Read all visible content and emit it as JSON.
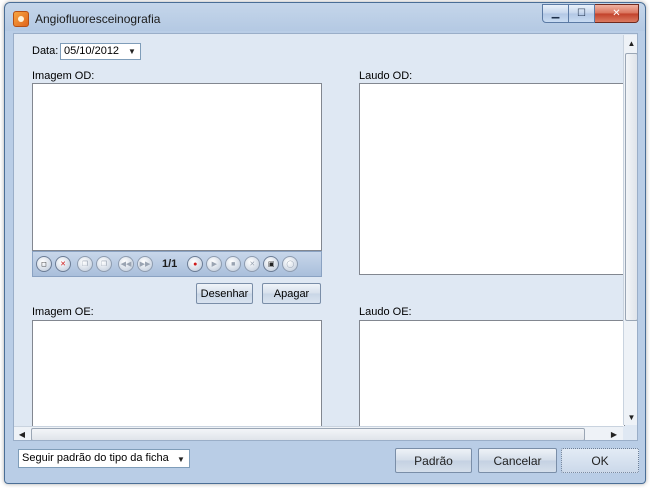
{
  "window": {
    "title": "Angiofluoresceinografia",
    "caption": {
      "minimize": "▁",
      "maximize": "☐",
      "close": "✕"
    }
  },
  "date": {
    "label": "Data:",
    "value": "05/10/2012",
    "arrow": "▼"
  },
  "image_od": {
    "label": "Imagem OD:",
    "toolbar": {
      "page_count": "1/1",
      "icons": [
        "new-image-icon",
        "delete-image-icon",
        "copy-icon",
        "paste-icon",
        "rewind-icon",
        "forward-icon",
        "record-icon",
        "play-icon",
        "stop-icon",
        "clear-icon",
        "camera-icon",
        "ellipse-icon"
      ]
    }
  },
  "laudo_od": {
    "label": "Laudo OD:"
  },
  "draw_button": "Desenhar",
  "erase_button": "Apagar",
  "image_oe": {
    "label": "Imagem OE:"
  },
  "laudo_oe": {
    "label": "Laudo OE:"
  },
  "scroll": {
    "up": "▲",
    "down": "▼",
    "left": "◀",
    "right": "▶"
  },
  "footer": {
    "mode_select": {
      "value": "Seguir padrão do tipo da ficha",
      "arrow": "▼"
    },
    "default_button": "Padrão",
    "cancel_button": "Cancelar",
    "ok_button": "OK"
  }
}
